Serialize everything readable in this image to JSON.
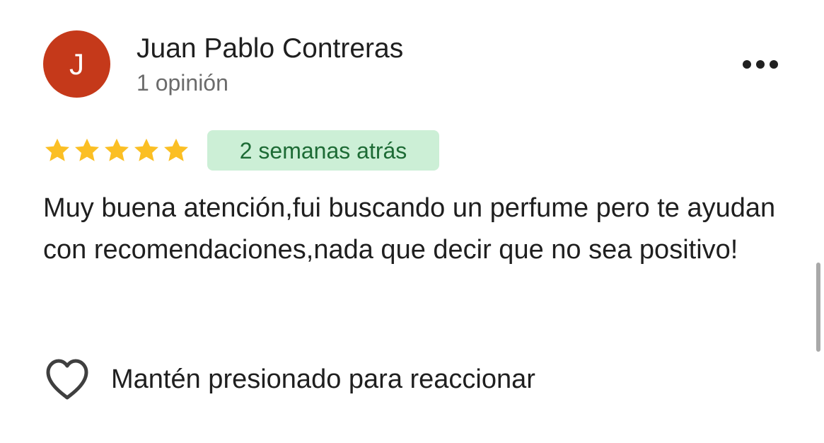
{
  "author": {
    "initial": "J",
    "name": "Juan Pablo Contreras",
    "meta": "1 opinión",
    "avatar_color": "#c5391a"
  },
  "menu": {
    "icon": "more-horizontal-icon"
  },
  "rating": {
    "stars": 5,
    "max": 5,
    "star_color": "#fbbf24"
  },
  "time_badge": {
    "label": "2 semanas atrás",
    "background": "#ccefd6",
    "text_color": "#1d6b35"
  },
  "review": {
    "text": "Muy buena atención,fui buscando un perfume pero te ayudan con recomendaciones,nada que decir que no sea positivo!"
  },
  "reaction": {
    "icon": "heart-outline-icon",
    "label": "Mantén presionado para reaccionar"
  }
}
